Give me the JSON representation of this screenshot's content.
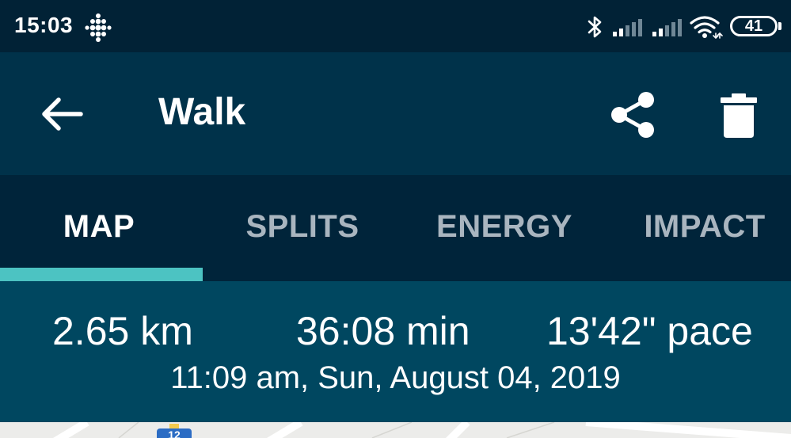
{
  "status_bar": {
    "time": "15:03",
    "battery_level": "41",
    "icons": [
      "fitbit-icon",
      "bluetooth-icon",
      "signal-icon",
      "signal-icon",
      "wifi-icon",
      "battery-icon"
    ]
  },
  "toolbar": {
    "title": "Walk",
    "back_icon": "back-arrow-icon",
    "share_icon": "share-icon",
    "delete_icon": "trash-icon"
  },
  "tabs": [
    {
      "label": "MAP",
      "active": true
    },
    {
      "label": "SPLITS",
      "active": false
    },
    {
      "label": "ENERGY",
      "active": false
    },
    {
      "label": "IMPACT",
      "active": false
    }
  ],
  "summary": {
    "distance": "2.65 km",
    "duration": "36:08 min",
    "pace": "13'42\" pace",
    "date": "11:09 am, Sun, August 04, 2019"
  },
  "colors": {
    "status_bar_bg": "#012236",
    "toolbar_bg": "#00324a",
    "tabs_bg": "#00243a",
    "tab_indicator": "#4cc3c2",
    "summary_bg": "#004760",
    "inactive_tab_text": "#a9b5bf",
    "map_bg": "#ececea",
    "route_badge": "#2b6cc4"
  },
  "map": {
    "route_badge_number": "12"
  }
}
